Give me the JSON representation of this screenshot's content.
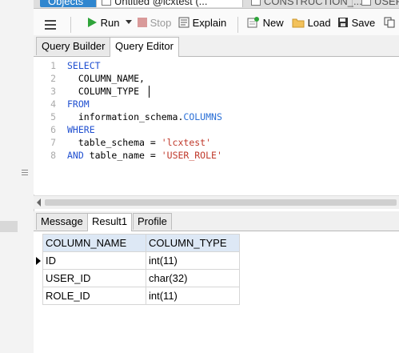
{
  "doc_tabs": [
    "Objects",
    "Untitled @lcxtest (...",
    "CONSTRUCTION_...",
    "USER @lcx..."
  ],
  "toolbar": {
    "run": "Run",
    "stop": "Stop",
    "explain": "Explain",
    "new": "New",
    "load": "Load",
    "save": "Save"
  },
  "editor_tabs": [
    "Query Builder",
    "Query Editor"
  ],
  "editor": {
    "line_numbers": [
      "1",
      "2",
      "3",
      "4",
      "5",
      "6",
      "7",
      "8"
    ],
    "lines": [
      {
        "kw": "SELECT",
        "text": ""
      },
      {
        "kw": "",
        "text": "  COLUMN_NAME,"
      },
      {
        "kw": "",
        "text": "  COLUMN_TYPE"
      },
      {
        "kw": "FROM",
        "text": ""
      },
      {
        "kw": "",
        "text": "  information_schema.",
        "id": "COLUMNS"
      },
      {
        "kw": "WHERE",
        "text": ""
      },
      {
        "kw": "",
        "text": "  table_schema = ",
        "str": "'lcxtest'"
      },
      {
        "kw": "AND",
        "text": " table_name = ",
        "str": "'USER_ROLE'"
      }
    ]
  },
  "result_tabs": [
    "Message",
    "Result1",
    "Profile"
  ],
  "grid": {
    "columns": [
      "COLUMN_NAME",
      "COLUMN_TYPE"
    ],
    "rows": [
      [
        "ID",
        "int(11)"
      ],
      [
        "USER_ID",
        "char(32)"
      ],
      [
        "ROLE_ID",
        "int(11)"
      ]
    ]
  },
  "colors": {
    "keyword": "#1f4fd0",
    "string": "#c0392b",
    "active_tab": "#2f86cf",
    "header_bg": "#dde8f5"
  }
}
